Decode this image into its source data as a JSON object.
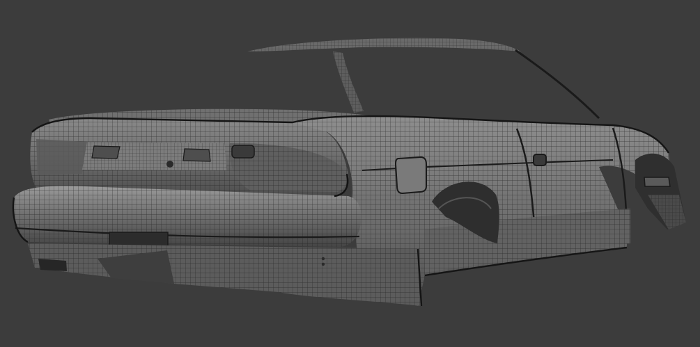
{
  "scene": {
    "description_visible_text": "",
    "background_color": "#3c3c3c",
    "mesh_base_color": "#6f6f6f",
    "mesh_shadow_color": "#4a4a4a",
    "mesh_highlight_color": "#9a9a9a",
    "wire_color": "#1c1c1c",
    "glass_color": "#5a5a5a"
  }
}
